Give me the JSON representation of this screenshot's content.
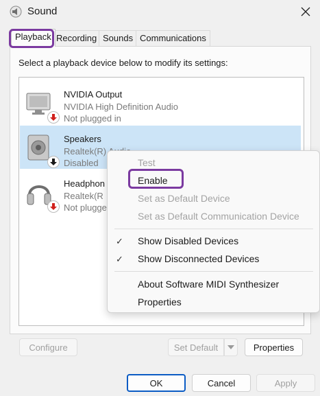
{
  "window": {
    "title": "Sound",
    "close_icon": "close-icon",
    "app_icon": "speaker-icon"
  },
  "tabs": [
    {
      "label": "Playback",
      "active": true
    },
    {
      "label": "Recording",
      "active": false
    },
    {
      "label": "Sounds",
      "active": false
    },
    {
      "label": "Communications",
      "active": false
    }
  ],
  "panel": {
    "instruction": "Select a playback device below to modify its settings:"
  },
  "devices": [
    {
      "name": "NVIDIA Output",
      "line1": "NVIDIA High Definition Audio",
      "line2": "Not plugged in",
      "icon": "monitor-speaker-icon",
      "badge": "red-down-arrow-icon",
      "selected": false
    },
    {
      "name": "Speakers",
      "line1": "Realtek(R) Audio",
      "line2": "Disabled",
      "icon": "speaker-icon",
      "badge": "black-down-arrow-icon",
      "selected": true
    },
    {
      "name": "Headphon",
      "line1": "Realtek(R",
      "line2": "Not plugge",
      "icon": "headphones-icon",
      "badge": "red-down-arrow-icon",
      "selected": false
    }
  ],
  "context_menu": {
    "items": [
      {
        "label": "Test",
        "enabled": false
      },
      {
        "label": "Enable",
        "enabled": true
      },
      {
        "label": "Set as Default Device",
        "enabled": false
      },
      {
        "label": "Set as Default Communication Device",
        "enabled": false
      },
      {
        "label": "Show Disabled Devices",
        "enabled": true,
        "checked": true
      },
      {
        "label": "Show Disconnected Devices",
        "enabled": true,
        "checked": true
      },
      {
        "label": "About Software MIDI Synthesizer",
        "enabled": true
      },
      {
        "label": "Properties",
        "enabled": true
      }
    ]
  },
  "panel_buttons": {
    "configure": "Configure",
    "set_default": "Set Default",
    "properties": "Properties"
  },
  "dialog_buttons": {
    "ok": "OK",
    "cancel": "Cancel",
    "apply": "Apply"
  },
  "colors": {
    "selection": "#cce4f7",
    "annotation": "#7b3aa0",
    "primary_border": "#0a5bc4",
    "disabled_text": "#a3a3a3"
  }
}
